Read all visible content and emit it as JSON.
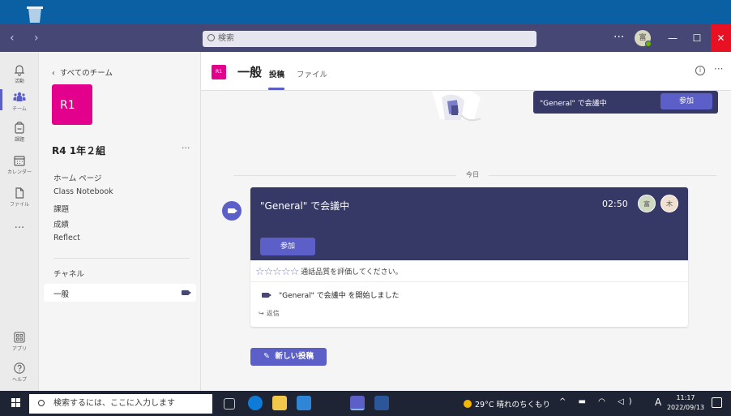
{
  "titlebar": {
    "nav": "‹ ›",
    "search_placeholder": "検索",
    "more": "···",
    "avatar_initial": "富",
    "minimize": "—",
    "maximize": "☐",
    "close": "✕"
  },
  "rail": {
    "items": [
      {
        "label": "活動",
        "icon": "bell-icon"
      },
      {
        "label": "チーム",
        "icon": "teams-icon",
        "active": true
      },
      {
        "label": "課題",
        "icon": "assignments-icon"
      },
      {
        "label": "カレンダー",
        "icon": "calendar-icon"
      },
      {
        "label": "ファイル",
        "icon": "file-icon"
      },
      {
        "label": "···",
        "icon": "more-icon"
      }
    ],
    "bottom": [
      {
        "label": "アプリ",
        "icon": "apps-icon"
      },
      {
        "label": "ヘルプ",
        "icon": "help-icon"
      }
    ]
  },
  "panel": {
    "back_label": "すべてのチーム",
    "team_tile": "R1",
    "team_name": "R4 1年２組",
    "team_more": "···",
    "links": [
      "ホーム ページ",
      "Class Notebook",
      "課題",
      "成績",
      "Reflect"
    ],
    "channels_heading": "チャネル",
    "channel": "一般"
  },
  "header": {
    "badge": "R1",
    "title": "一般",
    "tabs": [
      "投稿",
      "ファイル"
    ],
    "active_tab": "投稿",
    "info": "i",
    "more": "···"
  },
  "feed": {
    "mini_banner_text": "\"General\" で会議中",
    "mini_banner_join": "参加",
    "today_label": "今日",
    "meeting": {
      "title": "\"General\" で会議中",
      "time": "02:50",
      "participants": [
        "富",
        "木"
      ],
      "join_label": "参加",
      "stars": "☆☆☆☆☆",
      "rate_text": "通話品質を評価してください。",
      "started_text": "\"General\" で会議中 を開始しました",
      "reply_label": "返信"
    },
    "new_post_label": "新しい投稿"
  },
  "taskbar": {
    "search_placeholder": "検索するには、ここに入力します",
    "weather": "29°C 晴れのちくもり",
    "ime": "A",
    "time": "11:17",
    "date": "2022/09/13"
  },
  "colors": {
    "teams_purple": "#464775",
    "meeting_banner": "#363866",
    "accent": "#5b5fc7",
    "team_tile": "#e3008c"
  }
}
